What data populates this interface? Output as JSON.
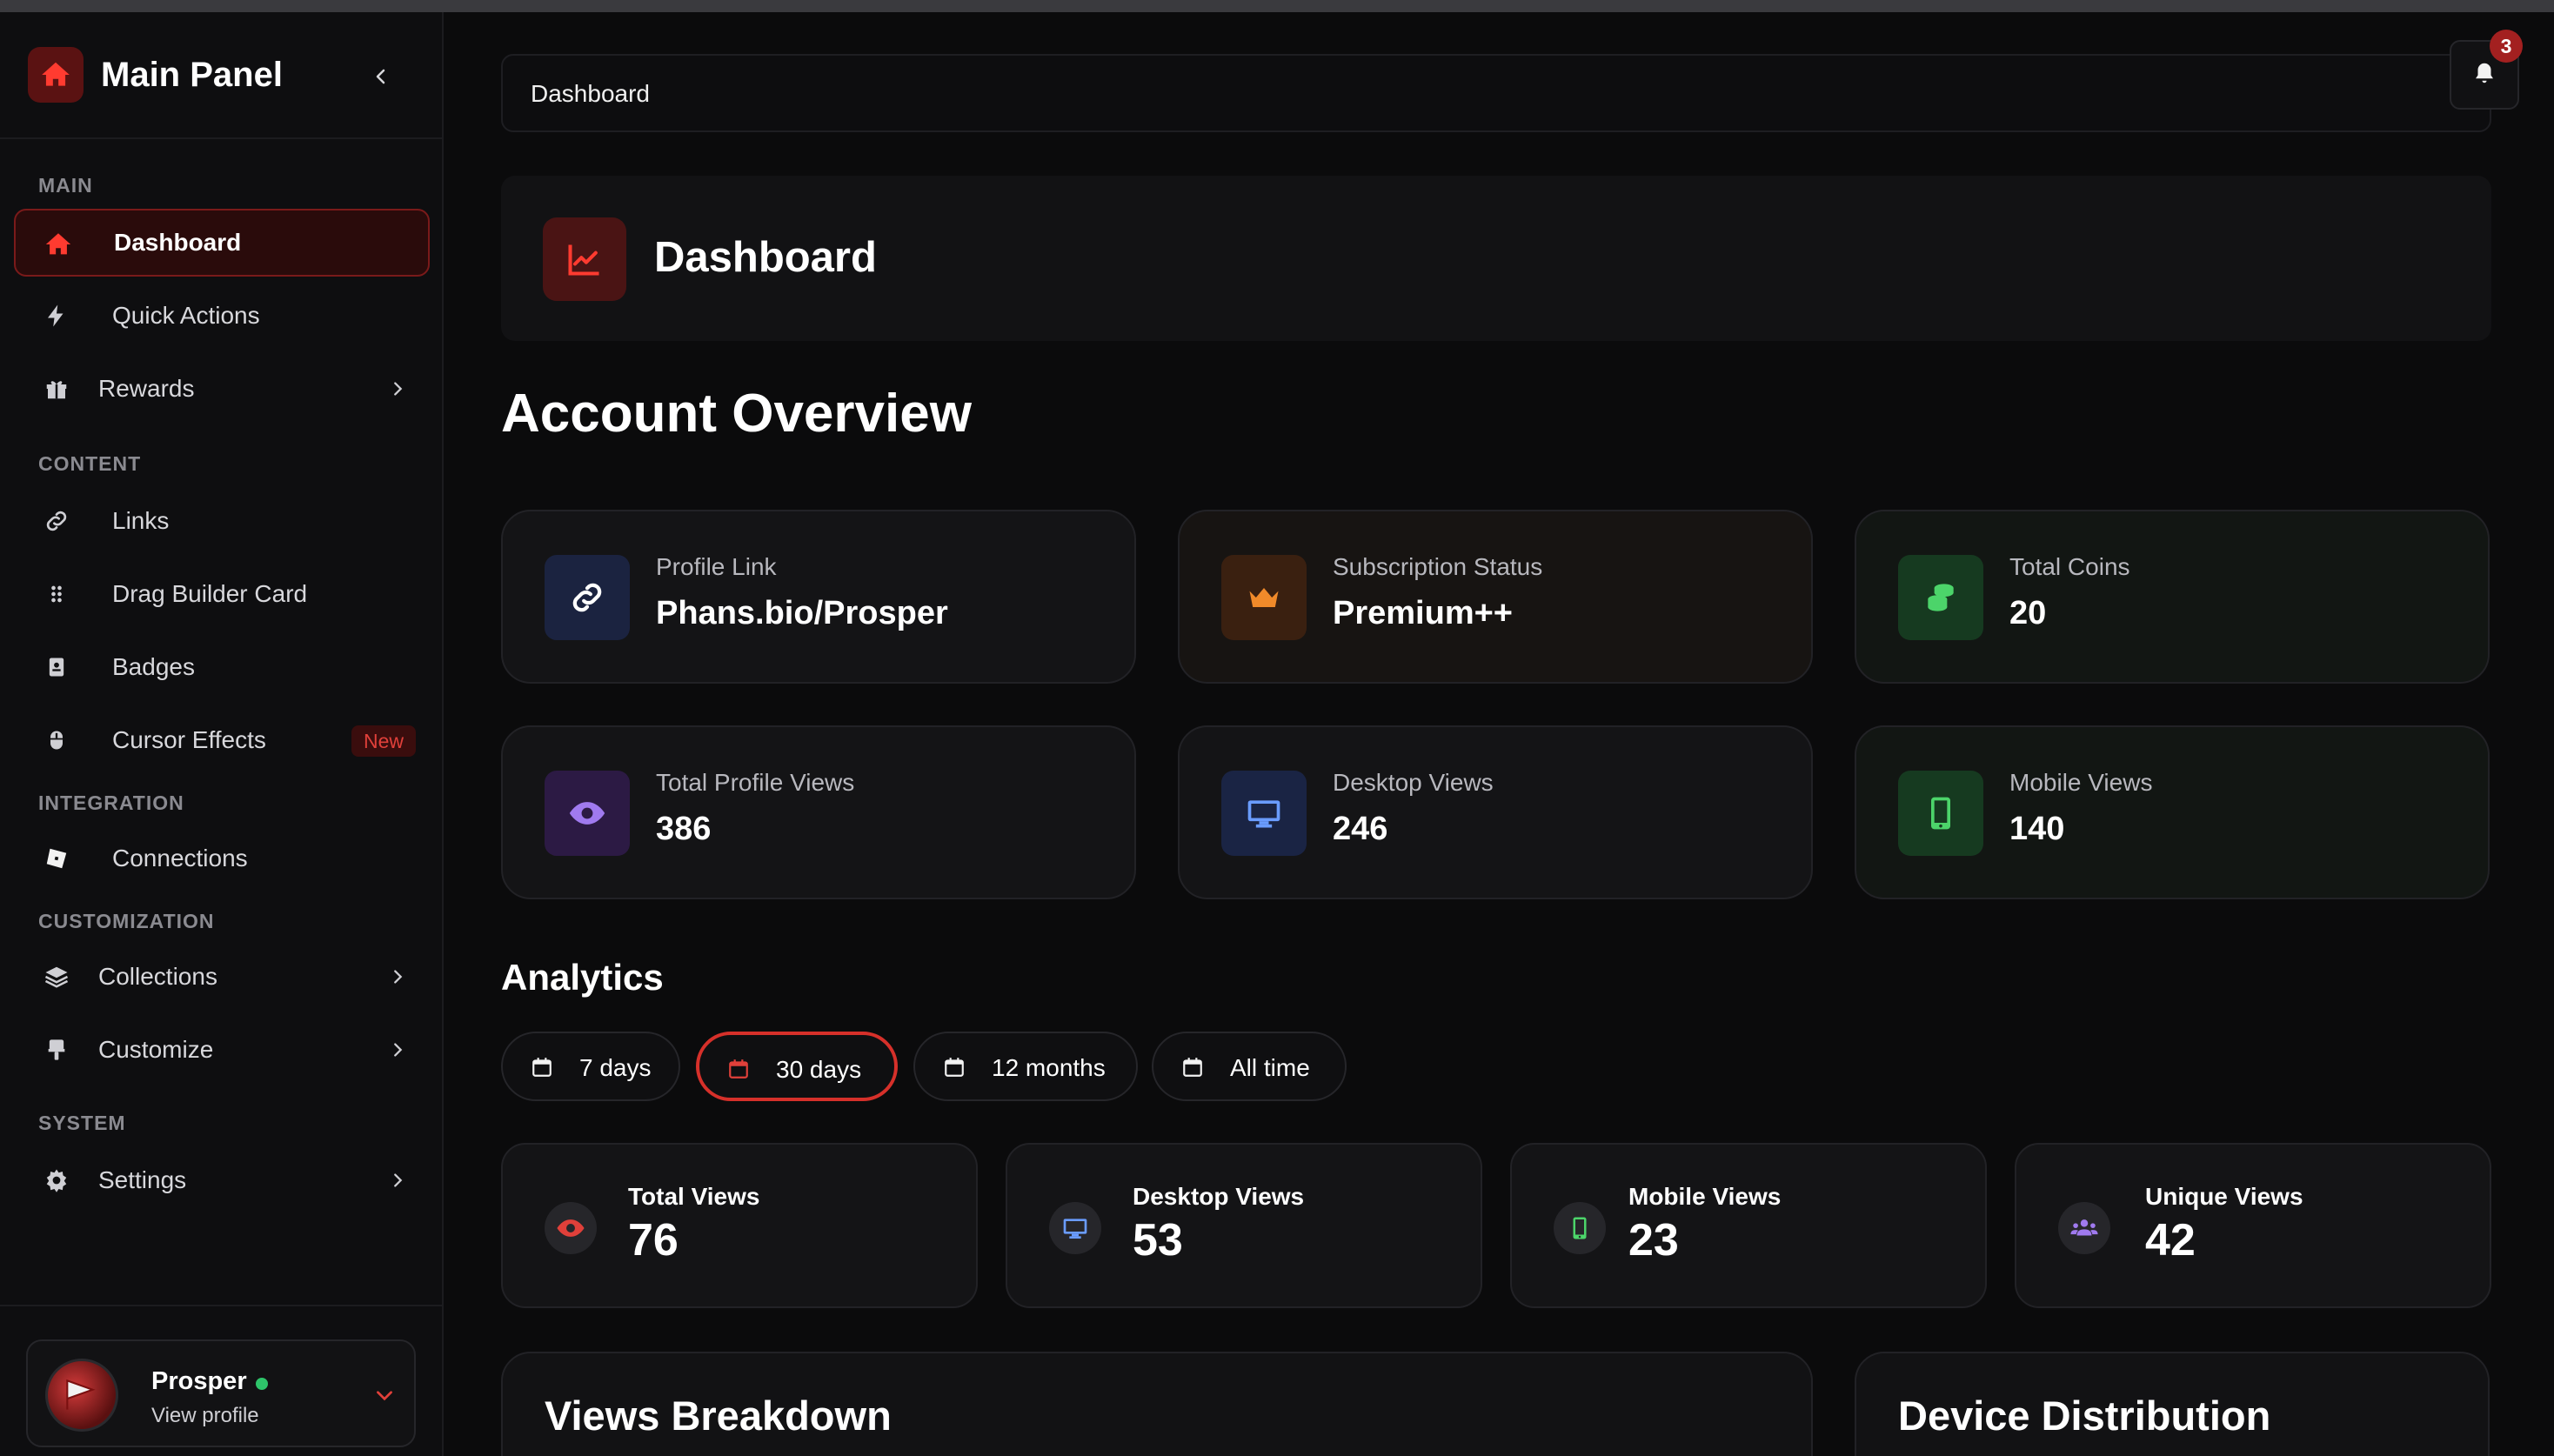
{
  "brand": {
    "title": "Main Panel"
  },
  "sidebar": {
    "sections": {
      "main": "MAIN",
      "content": "CONTENT",
      "integration": "INTEGRATION",
      "customization": "CUSTOMIZATION",
      "system": "SYSTEM"
    },
    "items": {
      "dashboard": "Dashboard",
      "quick_actions": "Quick Actions",
      "rewards": "Rewards",
      "links": "Links",
      "drag_builder_card": "Drag Builder Card",
      "badges": "Badges",
      "cursor_effects": "Cursor Effects",
      "cursor_effects_badge": "New",
      "connections": "Connections",
      "collections": "Collections",
      "customize": "Customize",
      "settings": "Settings"
    },
    "profile": {
      "name": "Prosper",
      "sub": "View profile"
    }
  },
  "breadcrumb": "Dashboard",
  "notifications": {
    "count": "3"
  },
  "header": {
    "title": "Dashboard"
  },
  "overview": {
    "title": "Account Overview",
    "cards": [
      {
        "label": "Profile Link",
        "value": "Phans.bio/Prosper"
      },
      {
        "label": "Subscription Status",
        "value": "Premium++"
      },
      {
        "label": "Total Coins",
        "value": "20"
      },
      {
        "label": "Total Profile Views",
        "value": "386"
      },
      {
        "label": "Desktop Views",
        "value": "246"
      },
      {
        "label": "Mobile Views",
        "value": "140"
      }
    ]
  },
  "analytics": {
    "title": "Analytics",
    "ranges": [
      "7 days",
      "30 days",
      "12 months",
      "All time"
    ],
    "active_range": "30 days",
    "metrics": [
      {
        "label": "Total Views",
        "value": "76"
      },
      {
        "label": "Desktop Views",
        "value": "53"
      },
      {
        "label": "Mobile Views",
        "value": "23"
      },
      {
        "label": "Unique Views",
        "value": "42"
      }
    ]
  },
  "panels": {
    "views_breakdown": "Views Breakdown",
    "device_distribution": "Device Distribution"
  },
  "colors": {
    "accent": "#d6302a",
    "bg": "#0b0b0c",
    "card": "#141416"
  }
}
